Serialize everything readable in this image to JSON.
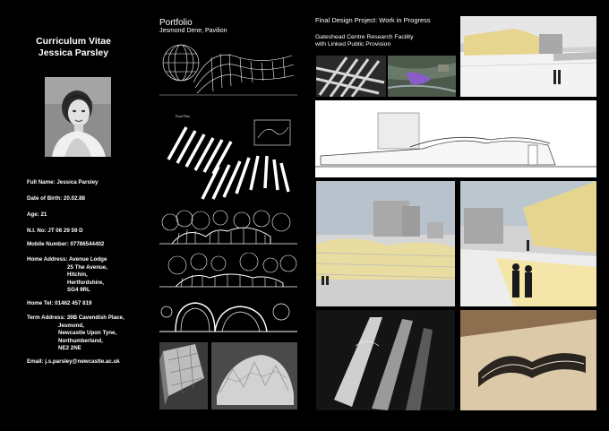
{
  "cv": {
    "title": "Curriculum Vitae",
    "name": "Jessica Parsley",
    "full_name": "Full Name: Jessica Parsley",
    "dob": "Date of Birth: 20.02.88",
    "age": "Age: 21",
    "ni": "N.I. No: JT 06 29 59 D",
    "mobile": "Mobile Number: 07786544402",
    "home_address": [
      "Home Address: Avenue Lodge",
      "25 The Avenue,",
      "Hitchin,",
      "Hertfordshire,",
      "SG4 9RL"
    ],
    "home_tel": "Home Tel: 01462 457 819",
    "term_address": [
      "Term Address: 39B Cavendish Place,",
      "Jesmond,",
      "Newcastle Upon Tyne,",
      "Northumberland,",
      "NE2 2NE"
    ],
    "email": "Email: j.s.parsley@newcastle.ac.uk"
  },
  "portfolio": {
    "title": "Portfolio",
    "subtitle": "Jesmond Dene, Pavilion",
    "roof_plan_label": "Roof Plan"
  },
  "project": {
    "title": "Final Design Project: Work in Progress",
    "subtitle_line1": "Gateshead Centre Research Facility",
    "subtitle_line2": "with Linked Public Provision"
  },
  "colors": {
    "background": "#000000",
    "text": "#ffffff",
    "accent_yellow": "#e8d48a",
    "highlight_purple": "#8a5cc8"
  }
}
